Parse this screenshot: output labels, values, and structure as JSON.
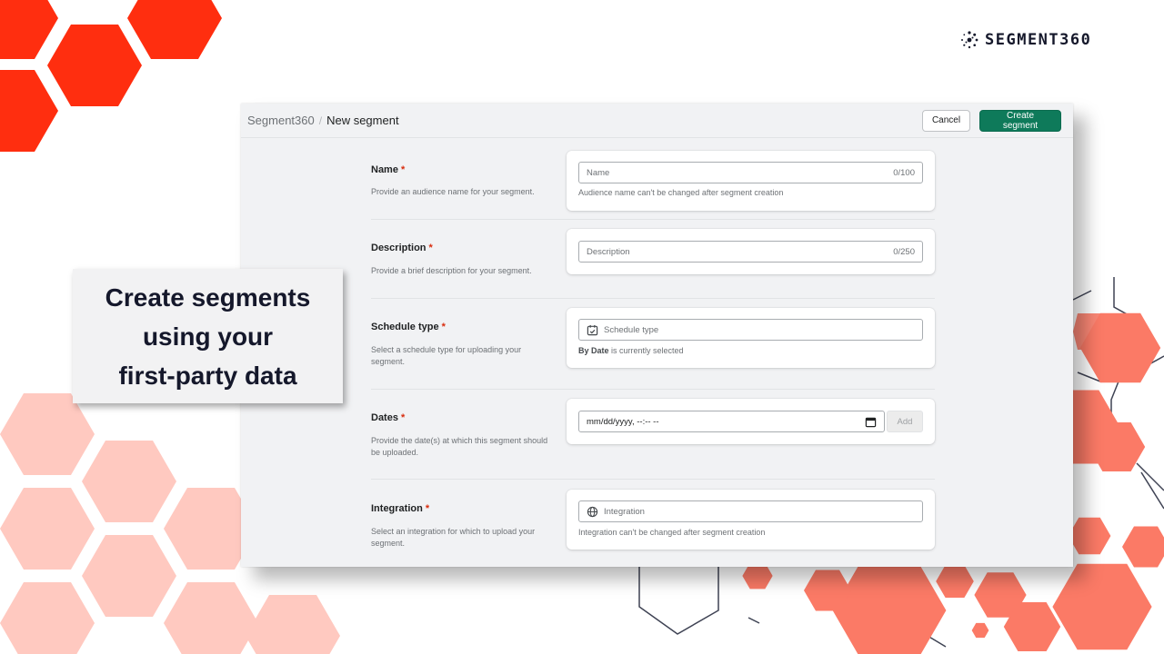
{
  "brand": {
    "name": "SEGMENT360",
    "icon": "dots-ring-logo-icon"
  },
  "header": {
    "breadcrumb_root": "Segment360",
    "breadcrumb_sep": "/",
    "title": "New segment",
    "cancel_label": "Cancel",
    "create_label": "Create segment"
  },
  "form": {
    "name": {
      "label": "Name",
      "required": "*",
      "help": "Provide an audience name for your segment.",
      "placeholder": "Name",
      "counter": "0/100",
      "note": "Audience name can't be changed after segment creation"
    },
    "description": {
      "label": "Description",
      "required": "*",
      "help": "Provide a brief description for your segment.",
      "placeholder": "Description",
      "counter": "0/250"
    },
    "schedule": {
      "label": "Schedule type",
      "required": "*",
      "help": "Select a schedule type for uploading your segment.",
      "placeholder": "Schedule type",
      "icon": "calendar-check-icon",
      "note_bold": "By Date",
      "note_rest": "is currently selected"
    },
    "dates": {
      "label": "Dates",
      "required": "*",
      "help": "Provide the date(s) at which this segment should be uploaded.",
      "placeholder": "mm/dd/yyyy, --:-- --",
      "icon": "calendar-icon",
      "add_label": "Add"
    },
    "integration": {
      "label": "Integration",
      "required": "*",
      "help": "Select an integration for which to upload your segment.",
      "placeholder": "Integration",
      "icon": "globe-icon",
      "note": "Integration can't be changed after segment creation"
    }
  },
  "callout": {
    "line1": "Create segments",
    "line2": "using your",
    "line3": "first-party data"
  },
  "colors": {
    "accent": "#0e7a5a",
    "required": "#d82c0d",
    "hex_red": "#ff2e0f",
    "hex_pink": "#ffc9c0",
    "hex_coral": "#fb7a66",
    "brand_text": "#15182b"
  }
}
